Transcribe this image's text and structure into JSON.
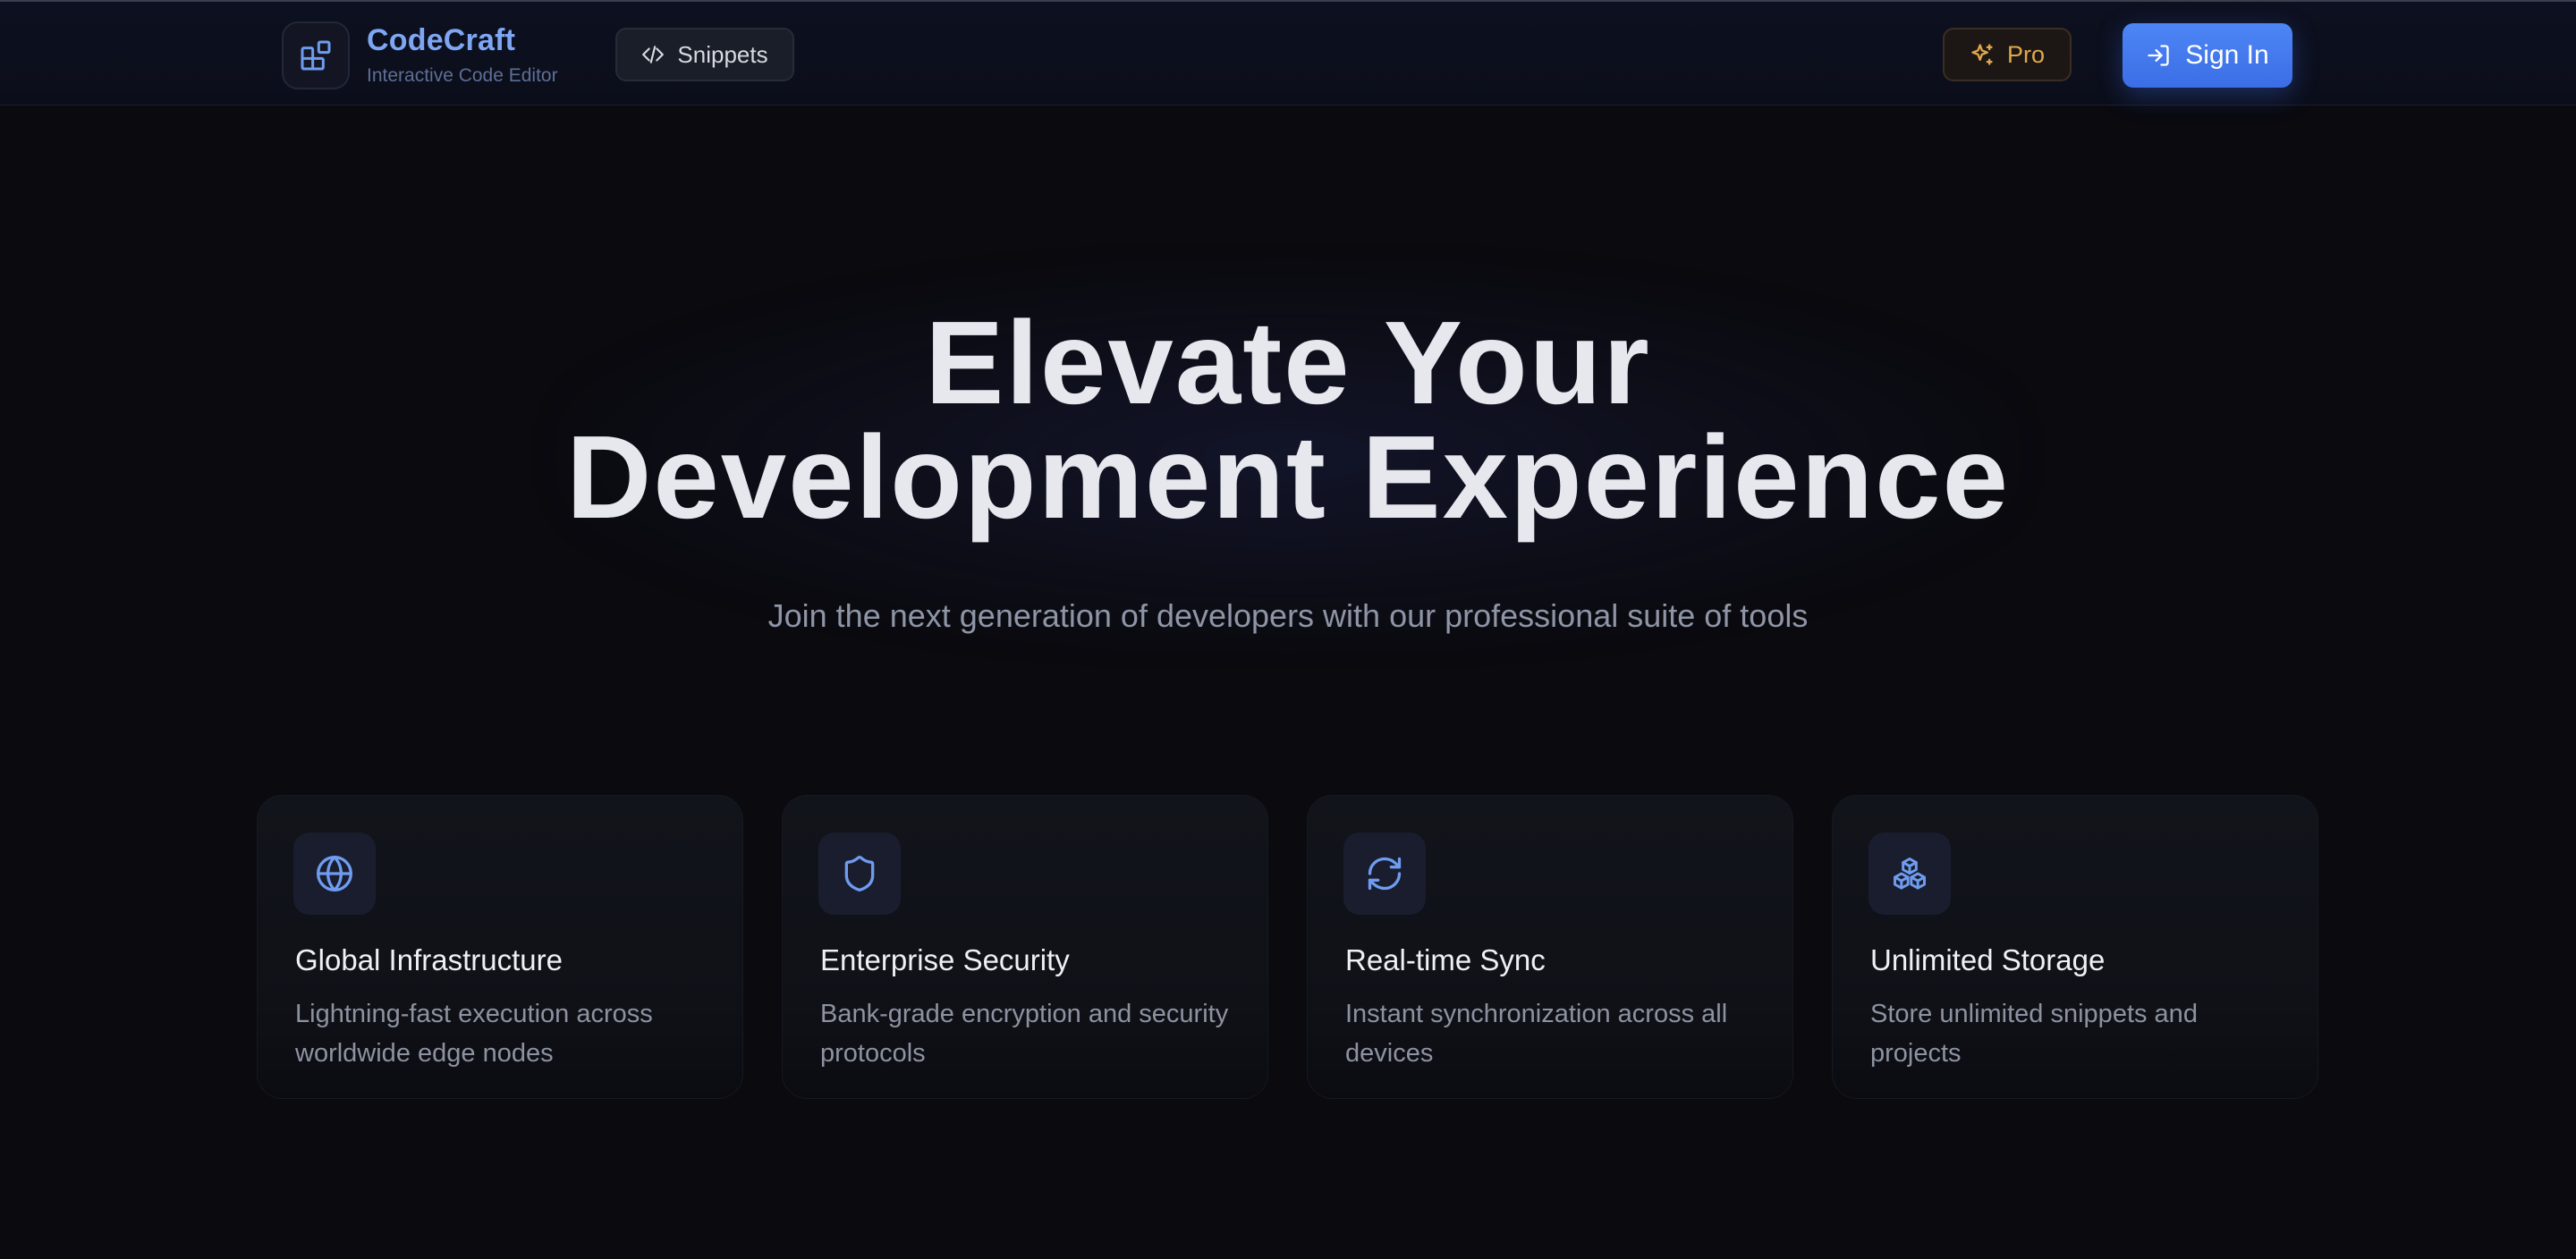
{
  "header": {
    "brand_name": "CodeCraft",
    "brand_subtitle": "Interactive Code Editor",
    "snippets_label": "Snippets",
    "pro_label": "Pro",
    "signin_label": "Sign In"
  },
  "hero": {
    "title_line1": "Elevate Your",
    "title_line2": "Development Experience",
    "subtitle": "Join the next generation of developers with our professional suite of tools"
  },
  "features": [
    {
      "icon": "globe-icon",
      "title": "Global Infrastructure",
      "description": "Lightning-fast execution across worldwide edge nodes"
    },
    {
      "icon": "shield-icon",
      "title": "Enterprise Security",
      "description": "Bank-grade encryption and security protocols"
    },
    {
      "icon": "refresh-icon",
      "title": "Real-time Sync",
      "description": "Instant synchronization across all devices"
    },
    {
      "icon": "boxes-icon",
      "title": "Unlimited Storage",
      "description": "Store unlimited snippets and projects"
    }
  ],
  "colors": {
    "background": "#0a0a0f",
    "accent_blue": "#3b6ee6",
    "brand_text": "#7ea6f2",
    "pro_accent": "#e0a84a",
    "icon_blue": "#6f9cf0"
  }
}
